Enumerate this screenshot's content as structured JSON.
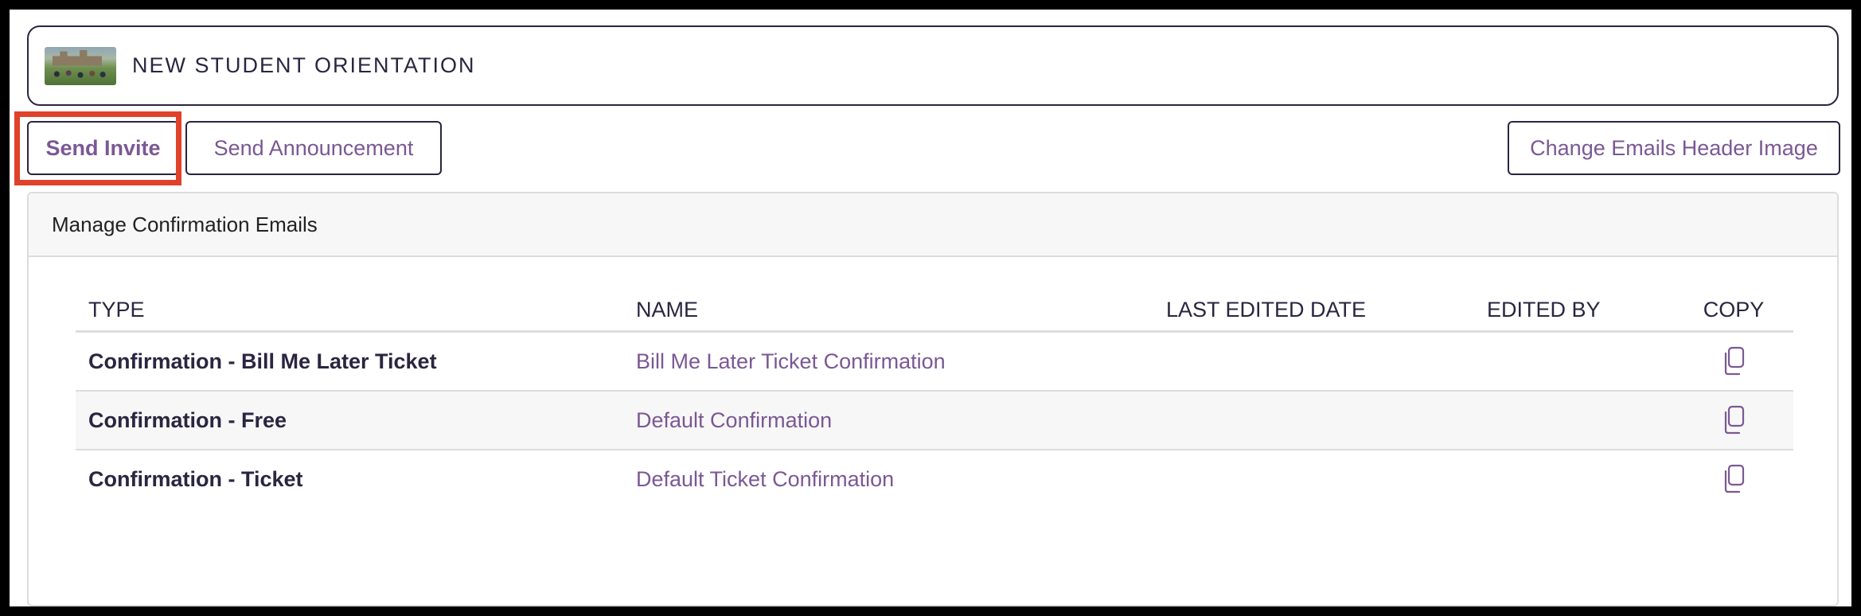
{
  "event": {
    "title": "NEW STUDENT ORIENTATION"
  },
  "actions": {
    "send_invite": "Send Invite",
    "send_announcement": "Send Announcement",
    "change_header_image": "Change Emails Header Image"
  },
  "panel": {
    "title": "Manage Confirmation Emails",
    "columns": [
      "TYPE",
      "NAME",
      "LAST EDITED DATE",
      "EDITED BY",
      "COPY"
    ],
    "rows": [
      {
        "type": "Confirmation - Bill Me Later Ticket",
        "name": "Bill Me Later Ticket Confirmation",
        "last_edited": "",
        "edited_by": "",
        "copy_icon": "copy-icon"
      },
      {
        "type": "Confirmation - Free",
        "name": "Default Confirmation",
        "last_edited": "",
        "edited_by": "",
        "copy_icon": "copy-icon"
      },
      {
        "type": "Confirmation - Ticket",
        "name": "Default Ticket Confirmation",
        "last_edited": "",
        "edited_by": "",
        "copy_icon": "copy-icon"
      }
    ]
  },
  "colors": {
    "accent_purple": "#7b5894",
    "dark_text": "#2b2540",
    "highlight": "#e0412a"
  }
}
